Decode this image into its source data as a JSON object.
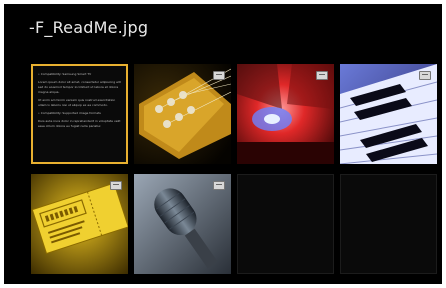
{
  "header": {
    "title": "-F_ReadMe.jpg"
  },
  "thumbnails": [
    {
      "kind": "readme-document",
      "selected": true,
      "paragraphs": [
        "• Compatibility: Samsung Smart TV",
        "Lorem ipsum dolor sit amet, consectetur adipiscing elit sed do eiusmod tempor incididunt ut labore et dolore magna aliqua.",
        "Ut enim ad minim veniam quis nostrud exercitation ullamco laboris nisi ut aliquip ex ea commodo.",
        "• Compatibility: Supported image formats",
        "Duis aute irure dolor in reprehenderit in voluptate velit esse cillum dolore eu fugiat nulla pariatur."
      ]
    },
    {
      "kind": "photo-guitar"
    },
    {
      "kind": "photo-concert"
    },
    {
      "kind": "photo-piano"
    },
    {
      "kind": "photo-ticket"
    },
    {
      "kind": "photo-microphone"
    },
    {
      "kind": "empty-slot"
    },
    {
      "kind": "empty-slot"
    }
  ],
  "colors": {
    "selection": "#e8b030",
    "background": "#000000",
    "title": "#e8e8e8"
  },
  "icons": {
    "photo_badge": "image-type-icon"
  }
}
